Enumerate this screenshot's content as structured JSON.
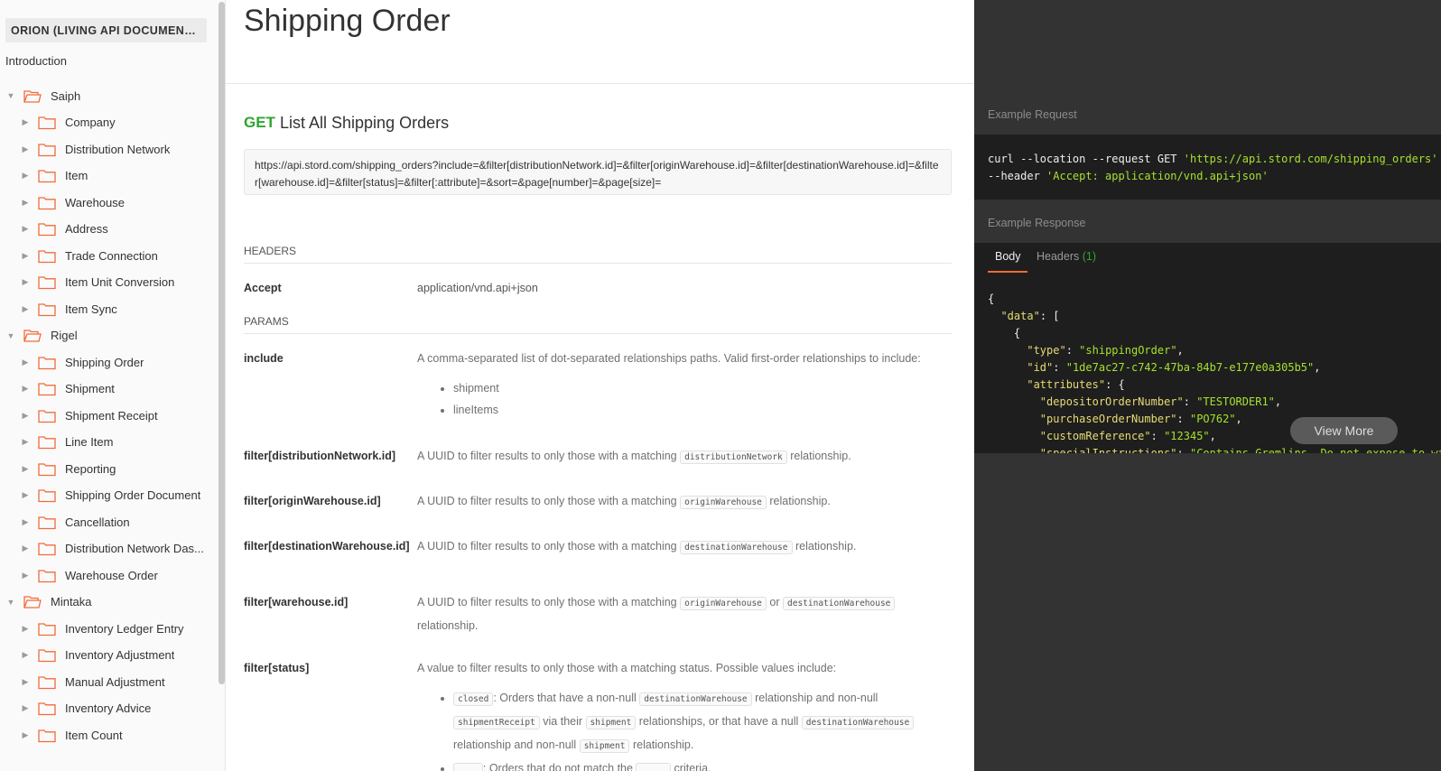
{
  "sidebar": {
    "collection_title": "ORION (LIVING API DOCUMENTATI...",
    "intro": "Introduction",
    "groups": [
      {
        "label": "Saiph",
        "items": [
          "Company",
          "Distribution Network",
          "Item",
          "Warehouse",
          "Address",
          "Trade Connection",
          "Item Unit Conversion",
          "Item Sync"
        ]
      },
      {
        "label": "Rigel",
        "items": [
          "Shipping Order",
          "Shipment",
          "Shipment Receipt",
          "Line Item",
          "Reporting",
          "Shipping Order Document",
          "Cancellation",
          "Distribution Network Das...",
          "Warehouse Order"
        ]
      },
      {
        "label": "Mintaka",
        "items": [
          "Inventory Ledger Entry",
          "Inventory Adjustment",
          "Manual Adjustment",
          "Inventory Advice",
          "Item Count"
        ]
      }
    ]
  },
  "doc": {
    "page_title": "Shipping Order",
    "method": "GET",
    "request_name": "List All Shipping Orders",
    "url": "https://api.stord.com/shipping_orders?include=&filter[distributionNetwork.id]=&filter[originWarehouse.id]=&filter[destinationWarehouse.id]=&filter[warehouse.id]=&filter[status]=&filter[:attribute]=&sort=&page[number]=&page[size]=",
    "headers_title": "HEADERS",
    "header_accept_name": "Accept",
    "header_accept_value": "application/vnd.api+json",
    "params_title": "PARAMS",
    "params": {
      "include_name": "include",
      "include_desc": "A comma-separated list of dot-separated relationships paths. Valid first-order relationships to include:",
      "include_opt1": "shipment",
      "include_opt2": "lineItems",
      "dn_name": "filter[distributionNetwork.id]",
      "dn_desc_pre": "A UUID to filter results to only those with a matching",
      "dn_code": "distributionNetwork",
      "dn_desc_post": "relationship.",
      "ow_name": "filter[originWarehouse.id]",
      "ow_desc_pre": "A UUID to filter results to only those with a matching",
      "ow_code": "originWarehouse",
      "ow_desc_post": "relationship.",
      "dw_name": "filter[destinationWarehouse.id]",
      "dw_desc_pre": "A UUID to filter results to only those with a matching",
      "dw_code": "destinationWarehouse",
      "dw_desc_post": "relationship.",
      "wh_name": "filter[warehouse.id]",
      "wh_desc_pre": "A UUID to filter results to only those with a matching",
      "wh_code1": "originWarehouse",
      "wh_or": "or",
      "wh_code2": "destinationWarehouse",
      "wh_desc_post": "relationship.",
      "st_name": "filter[status]",
      "st_desc": "A value to filter results to only those with a matching status. Possible values include:",
      "st_closed_code": "closed",
      "st_closed_t1": ": Orders that have a non-null",
      "st_closed_c2": "destinationWarehouse",
      "st_closed_t2": "relationship and non-null",
      "st_closed_c3": "shipmentReceipt",
      "st_closed_t3": "via their",
      "st_closed_c4": "shipment",
      "st_closed_t4": "relationships, or that have a null",
      "st_closed_c5": "destinationWarehouse",
      "st_closed_t5": "relationship and non-null",
      "st_closed_c6": "shipment",
      "st_closed_t6": "relationship.",
      "st_open_t1": ": Orders that do not match the",
      "st_open_t2": "criteria."
    }
  },
  "right": {
    "example_request": "Example Request",
    "example_response": "Example Response",
    "tab_body": "Body",
    "tab_headers": "Headers",
    "tab_headers_count": "(1)",
    "view_more": "View More"
  }
}
